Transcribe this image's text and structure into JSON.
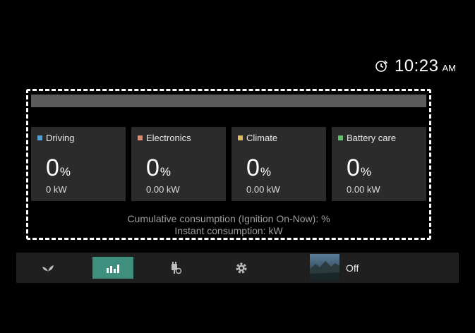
{
  "status": {
    "time": "10:23",
    "ampm": "AM"
  },
  "cards": [
    {
      "label": "Driving",
      "color": "#4aa3e0",
      "percent": "0",
      "percent_unit": "%",
      "power": "0 kW"
    },
    {
      "label": "Electronics",
      "color": "#e0886a",
      "percent": "0",
      "percent_unit": "%",
      "power": "0.00 kW"
    },
    {
      "label": "Climate",
      "color": "#e0b860",
      "percent": "0",
      "percent_unit": "%",
      "power": "0.00 kW"
    },
    {
      "label": "Battery care",
      "color": "#5cc26a",
      "percent": "0",
      "percent_unit": "%",
      "power": "0.00 kW"
    }
  ],
  "summary": {
    "cumulative": "Cumulative consumption (Ignition On-Now): %",
    "instant": "Instant consumption: kW"
  },
  "bottom_bar": {
    "items": [
      {
        "icon": "eco-leaf-icon",
        "active": false
      },
      {
        "icon": "bar-chart-icon",
        "active": true
      },
      {
        "icon": "ev-charge-plug-icon",
        "active": false
      },
      {
        "icon": "gear-icon",
        "active": false
      }
    ],
    "media_label": "Off"
  }
}
